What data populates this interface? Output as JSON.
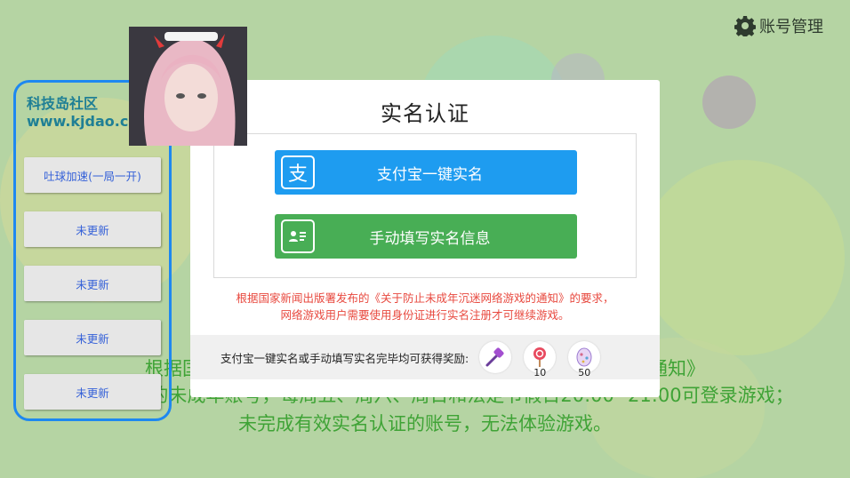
{
  "account": {
    "label": "账号管理",
    "icon": "gear-icon"
  },
  "background_text": {
    "line1": "根据国家新闻出版署发布的《关于防止未成年沉迷网络游戏的通知》",
    "line2": "已实名认证的未成年账号，每周五、周六、周日和法定节假日20:00--21:00可登录游戏；",
    "line3": "未完成有效实名认证的账号，无法体验游戏。"
  },
  "modal": {
    "title": "实名认证",
    "alipay_button": "支付宝一键实名",
    "manual_button": "手动填写实名信息",
    "notice_line1": "根据国家新闻出版署发布的《关于防止未成年沉迷网络游戏的通知》的要求，",
    "notice_line2": "网络游戏用户需要使用身份证进行实名注册才可继续游戏。",
    "reward_label": "支付宝一键实名或手动填写实名完毕均可获得奖励:",
    "rewards": [
      {
        "icon": "hammer-icon",
        "count": ""
      },
      {
        "icon": "lollipop-icon",
        "count": "10"
      },
      {
        "icon": "egg-icon",
        "count": "50"
      }
    ]
  },
  "side_menu": {
    "title_line1": "科技岛社区",
    "title_line2": "www.kjdao.cc",
    "items": [
      "吐球加速(一局一开)",
      "未更新",
      "未更新",
      "未更新",
      "未更新"
    ]
  },
  "colors": {
    "alipay": "#1e9cf0",
    "manual": "#48ae55",
    "notice": "#e8493f",
    "side_border": "#1e88f0"
  }
}
